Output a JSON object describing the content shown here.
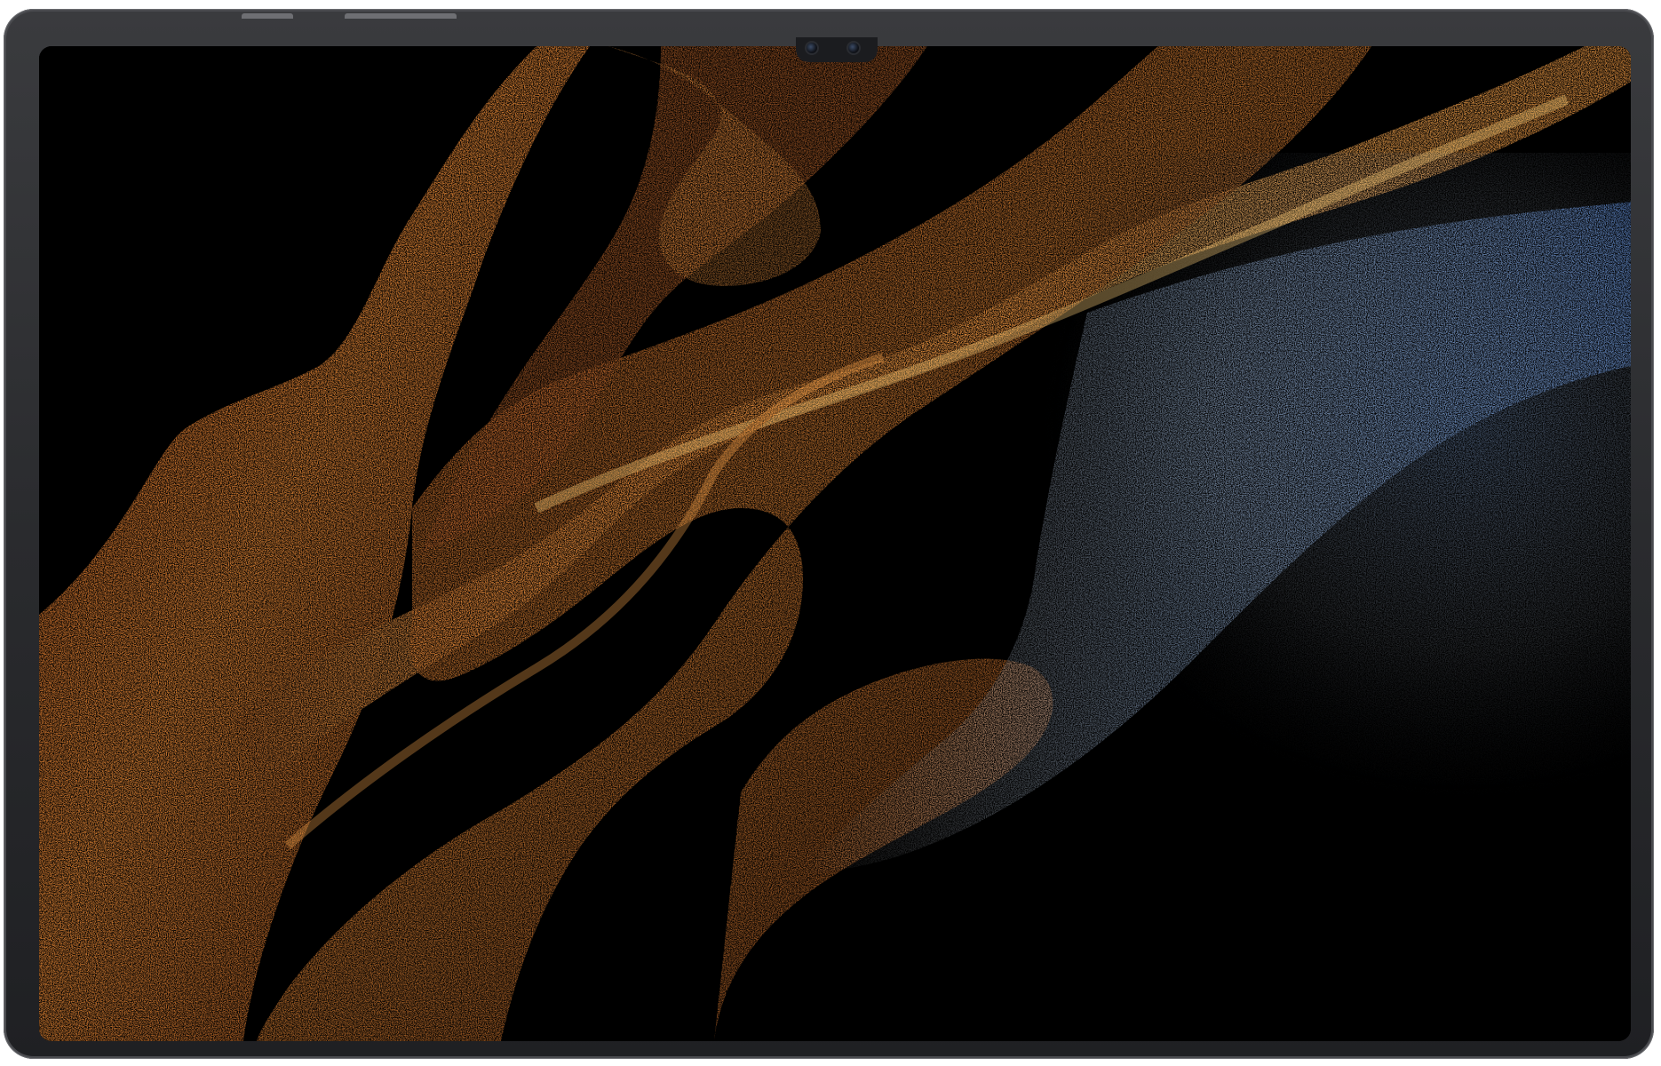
{
  "device": {
    "type": "tablet",
    "frame_color": "#2a2b2e",
    "screen_color": "#000000"
  },
  "wallpaper": {
    "theme": "particle waves",
    "colors": {
      "primary": "#d8782e",
      "secondary": "#f2a64d",
      "accent": "#6e95c9"
    }
  }
}
